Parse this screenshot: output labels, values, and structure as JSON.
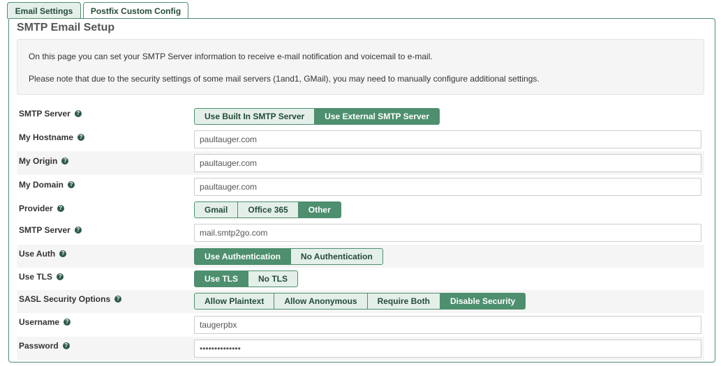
{
  "tabs": [
    {
      "label": "Email Settings",
      "active": true
    },
    {
      "label": "Postfix Custom Config",
      "active": false
    }
  ],
  "page_title": "SMTP Email Setup",
  "info": [
    "On this page you can set your SMTP Server information to receive e-mail notification and voicemail to e-mail.",
    "Please note that due to the security settings of some mail servers (1and1, GMail), you may need to manually configure additional settings."
  ],
  "colors": {
    "accent": "#4d8f6e",
    "accent_light": "#e4efe9",
    "row_alt": "#f5f5f5",
    "help_icon": "#2d5a47"
  },
  "help_icon": "question-circle-icon",
  "form": {
    "smtp_server_mode": {
      "label": "SMTP Server",
      "options": [
        "Use Built In SMTP Server",
        "Use External SMTP Server"
      ],
      "selected": "Use External SMTP Server"
    },
    "hostname": {
      "label": "My Hostname",
      "value": "paultauger.com"
    },
    "origin": {
      "label": "My Origin",
      "value": "paultauger.com"
    },
    "domain": {
      "label": "My Domain",
      "value": "paultauger.com"
    },
    "provider": {
      "label": "Provider",
      "options": [
        "Gmail",
        "Office 365",
        "Other"
      ],
      "selected": "Other"
    },
    "smtp_server_host": {
      "label": "SMTP Server",
      "value": "mail.smtp2go.com"
    },
    "use_auth": {
      "label": "Use Auth",
      "options": [
        "Use Authentication",
        "No Authentication"
      ],
      "selected": "Use Authentication"
    },
    "use_tls": {
      "label": "Use TLS",
      "options": [
        "Use TLS",
        "No TLS"
      ],
      "selected": "Use TLS"
    },
    "sasl": {
      "label": "SASL Security Options",
      "options": [
        "Allow Plaintext",
        "Allow Anonymous",
        "Require Both",
        "Disable Security"
      ],
      "selected": "Disable Security"
    },
    "username": {
      "label": "Username",
      "value": "taugerpbx"
    },
    "password": {
      "label": "Password",
      "value": "••••••••••••••"
    }
  }
}
